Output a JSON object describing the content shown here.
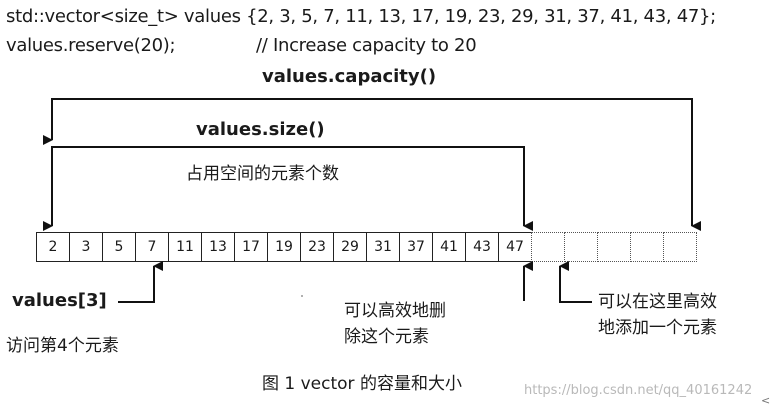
{
  "code": {
    "line1": "std::vector<size_t> values {2, 3, 5, 7, 11, 13, 17, 19, 23, 29, 31, 37, 41, 43, 47};",
    "line2": "values.reserve(20);",
    "line2_comment": "// Increase capacity to 20"
  },
  "labels": {
    "capacity": "values.capacity()",
    "size": "values.size()",
    "occupied": "占用空间的元素个数",
    "index": "values[3]",
    "access": "访问第4个元素",
    "delete_line1": "可以高效地删",
    "delete_line2": "除这个元素",
    "add_line1": "可以在这里高效",
    "add_line2": "地添加一个元素"
  },
  "cells": {
    "values": [
      "2",
      "3",
      "5",
      "7",
      "11",
      "13",
      "17",
      "19",
      "23",
      "29",
      "31",
      "37",
      "41",
      "43",
      "47"
    ],
    "empty_count": 5
  },
  "caption": "图 1 vector 的容量和大小",
  "watermark": "https://blog.csdn.net/qq_40161242",
  "corner_mark": "<"
}
